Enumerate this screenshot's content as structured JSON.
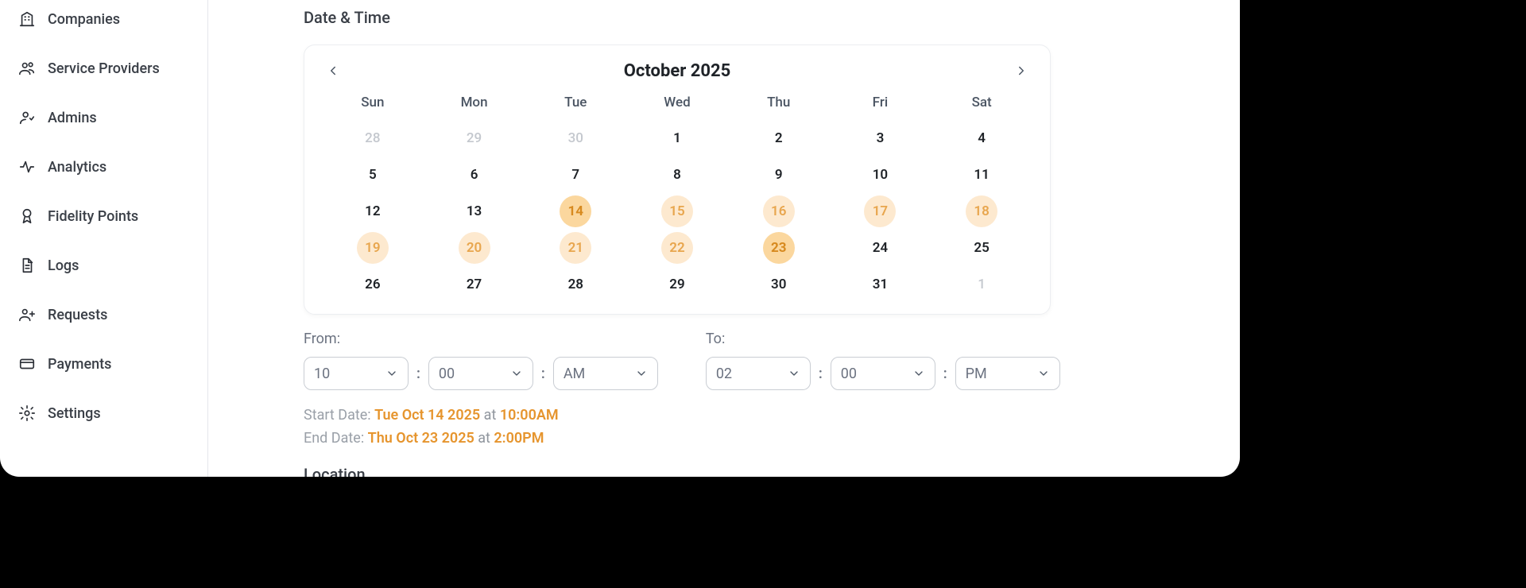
{
  "sidebar": {
    "items": [
      {
        "label": "Companies"
      },
      {
        "label": "Service Providers"
      },
      {
        "label": "Admins"
      },
      {
        "label": "Analytics"
      },
      {
        "label": "Fidelity Points"
      },
      {
        "label": "Logs"
      },
      {
        "label": "Requests"
      },
      {
        "label": "Payments"
      },
      {
        "label": "Settings"
      }
    ]
  },
  "section": {
    "date_time_title": "Date & Time",
    "location_title": "Location"
  },
  "calendar": {
    "month_label": "October 2025",
    "weekdays": [
      "Sun",
      "Mon",
      "Tue",
      "Wed",
      "Thu",
      "Fri",
      "Sat"
    ],
    "rows": [
      [
        {
          "d": "28",
          "muted": true
        },
        {
          "d": "29",
          "muted": true
        },
        {
          "d": "30",
          "muted": true
        },
        {
          "d": "1"
        },
        {
          "d": "2"
        },
        {
          "d": "3"
        },
        {
          "d": "4"
        }
      ],
      [
        {
          "d": "5"
        },
        {
          "d": "6"
        },
        {
          "d": "7"
        },
        {
          "d": "8"
        },
        {
          "d": "9"
        },
        {
          "d": "10"
        },
        {
          "d": "11"
        }
      ],
      [
        {
          "d": "12"
        },
        {
          "d": "13"
        },
        {
          "d": "14",
          "state": "range-end"
        },
        {
          "d": "15",
          "state": "range-mid"
        },
        {
          "d": "16",
          "state": "range-mid"
        },
        {
          "d": "17",
          "state": "range-mid"
        },
        {
          "d": "18",
          "state": "range-mid"
        }
      ],
      [
        {
          "d": "19",
          "state": "range-mid"
        },
        {
          "d": "20",
          "state": "range-mid"
        },
        {
          "d": "21",
          "state": "range-mid"
        },
        {
          "d": "22",
          "state": "range-mid"
        },
        {
          "d": "23",
          "state": "range-end"
        },
        {
          "d": "24"
        },
        {
          "d": "25"
        }
      ],
      [
        {
          "d": "26"
        },
        {
          "d": "27"
        },
        {
          "d": "28"
        },
        {
          "d": "29"
        },
        {
          "d": "30"
        },
        {
          "d": "31"
        },
        {
          "d": "1",
          "muted": true
        }
      ]
    ]
  },
  "time": {
    "from_label": "From:",
    "to_label": "To:",
    "colon": ":",
    "from": {
      "hour": "10",
      "minute": "00",
      "period": "AM"
    },
    "to": {
      "hour": "02",
      "minute": "00",
      "period": "PM"
    }
  },
  "summary": {
    "start_label": "Start Date: ",
    "start_date": "Tue Oct 14 2025",
    "at": " at ",
    "start_time": "10:00AM",
    "end_label": "End Date: ",
    "end_date": "Thu Oct 23 2025",
    "end_time": "2:00PM"
  }
}
